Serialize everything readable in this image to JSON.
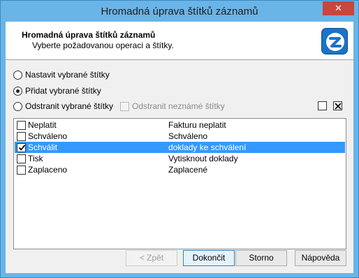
{
  "window": {
    "title": "Hromadná úprava štítků záznamů",
    "close_label": "✕"
  },
  "header": {
    "title": "Hromadná úprava štítků záznamů",
    "subtitle": "Vyberte požadovanou operaci a štítky.",
    "logo_icon": "app-logo-icon"
  },
  "options": {
    "set_label": "Nastavit vybrané štítky",
    "add_label": "Přidat vybrané štítky",
    "remove_label": "Odstranit vybrané štítky",
    "remove_unknown_label": "Odstranit neznámé štítky",
    "selected": "add"
  },
  "list": {
    "items": [
      {
        "name": "Neplatit",
        "description": "Fakturu neplatit",
        "checked": false,
        "selected": false
      },
      {
        "name": "Schváleno",
        "description": "Schváleno",
        "checked": false,
        "selected": false
      },
      {
        "name": "Schválit",
        "description": "doklady ke schválení",
        "checked": true,
        "selected": true
      },
      {
        "name": "Tisk",
        "description": "Vytisknout doklady",
        "checked": false,
        "selected": false
      },
      {
        "name": "Zaplaceno",
        "description": "Zaplacené",
        "checked": false,
        "selected": false
      }
    ]
  },
  "buttons": {
    "back_label": "< Zpět",
    "finish_label": "Dokončit",
    "cancel_label": "Storno",
    "help_label": "Nápověda"
  },
  "colors": {
    "titlebar": "#6ab4e7",
    "selection": "#3399ff",
    "close": "#c7463d"
  }
}
